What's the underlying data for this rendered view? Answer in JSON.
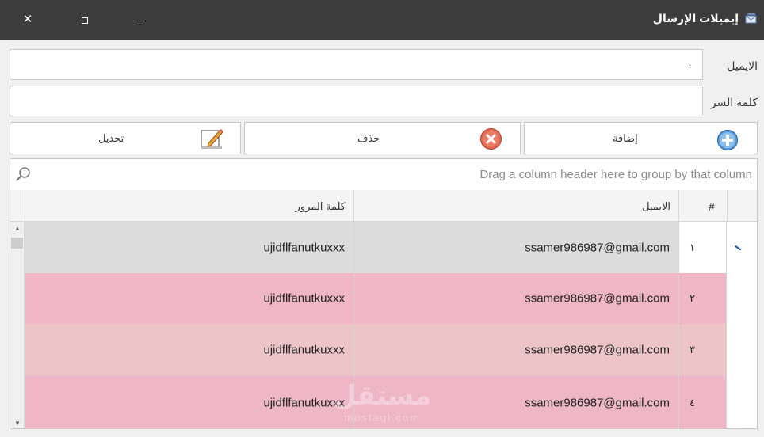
{
  "window": {
    "title": "إيميلات الإرسال",
    "close_glyph": "✕",
    "minimize_glyph": "–"
  },
  "form": {
    "email_label": "الايميل",
    "email_value": "٠",
    "password_label": "كلمة السر",
    "password_value": ""
  },
  "actions": {
    "add_label": "إضافة",
    "delete_label": "حذف",
    "edit_label": "تحديل"
  },
  "grid": {
    "group_hint": "Drag a column header here to group by that column",
    "columns": [
      "#",
      "الايميل",
      "كلمة المرور"
    ],
    "rows": [
      {
        "num": "١",
        "email": "ssamer986987@gmail.com",
        "password": "ujidflfanutkuxxx"
      },
      {
        "num": "٢",
        "email": "ssamer986987@gmail.com",
        "password": "ujidflfanutkuxxx"
      },
      {
        "num": "٣",
        "email": "ssamer986987@gmail.com",
        "password": "ujidflfanutkuxxx"
      },
      {
        "num": "٤",
        "email": "ssamer986987@gmail.com",
        "password": "ujidflfanutkuxxx"
      }
    ],
    "row_colors": [
      "#dcdcdc",
      "#efb6c8",
      "#edc5c8",
      "#efb6c8"
    ]
  },
  "watermark": {
    "text": "مستقل",
    "sub": "mostaql.com"
  }
}
